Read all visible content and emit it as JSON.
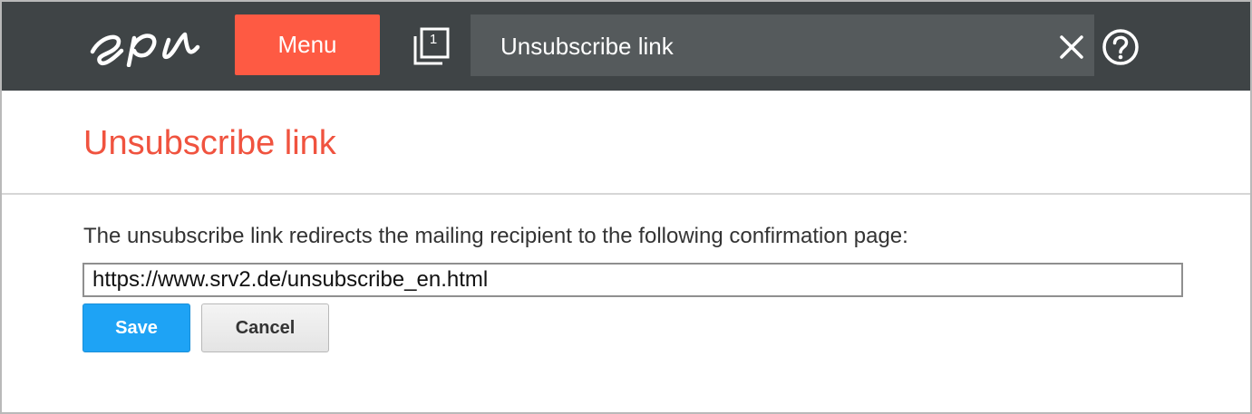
{
  "header": {
    "logo_name": "epi-logo",
    "menu_label": "Menu",
    "open_windows_count": "1",
    "search_value": "Unsubscribe link",
    "close_icon": "close-icon",
    "help_icon": "help-icon"
  },
  "main": {
    "title": "Unsubscribe link",
    "description": "The unsubscribe link redirects the mailing recipient to the following confirmation page:",
    "url_value": "https://www.srv2.de/unsubscribe_en.html",
    "save_label": "Save",
    "cancel_label": "Cancel"
  },
  "colors": {
    "header_bg": "#3f4446",
    "search_bg": "#555a5c",
    "accent": "#fe5a43",
    "title": "#f0533f",
    "primary_button": "#1ea3f5"
  }
}
